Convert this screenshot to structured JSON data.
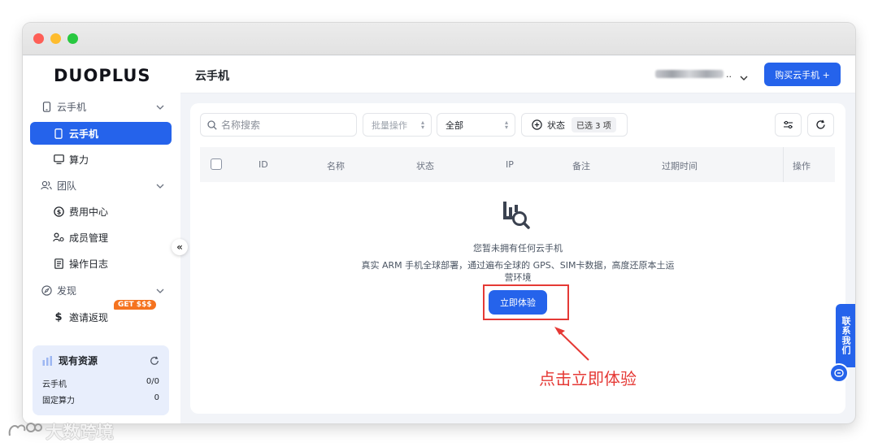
{
  "app": {
    "logo_text": "DUOPLUS",
    "page_title": "云手机",
    "account_suffix": "..",
    "buy_button": "购买云手机 +"
  },
  "sidebar": {
    "groups": [
      {
        "label": "云手机",
        "items": [
          {
            "label": "云手机",
            "active": true
          },
          {
            "label": "算力",
            "active": false
          }
        ]
      },
      {
        "label": "团队",
        "items": [
          {
            "label": "费用中心"
          },
          {
            "label": "成员管理"
          },
          {
            "label": "操作日志"
          }
        ]
      },
      {
        "label": "发现",
        "items": [
          {
            "label": "邀请返现",
            "badge": "GET $$$"
          }
        ]
      }
    ],
    "collapse_glyph": "«",
    "resources": {
      "title": "现有资源",
      "rows": [
        {
          "label": "云手机",
          "value": "0/0"
        },
        {
          "label": "固定算力",
          "value": "0"
        }
      ]
    }
  },
  "toolbar": {
    "search_placeholder": "名称搜索",
    "batch_label": "批量操作",
    "filter_all": "全部",
    "status_label": "状态",
    "status_selected": "已选 3 项"
  },
  "table": {
    "columns": [
      "ID",
      "名称",
      "状态",
      "IP",
      "备注",
      "过期时间",
      "操作"
    ]
  },
  "empty_state": {
    "title": "您暂未拥有任何云手机",
    "description": "真实 ARM 手机全球部署，通过遍布全球的 GPS、SIM卡数据，高度还原本土运营环境",
    "button": "立即体验"
  },
  "annotation": {
    "text": "点击立即体验",
    "color": "#e53935"
  },
  "contact": {
    "label": "联系我们"
  },
  "watermark": {
    "text": "大数跨境"
  },
  "colors": {
    "primary": "#2563eb",
    "badge": "#f5731f",
    "annotation": "#e53935"
  }
}
